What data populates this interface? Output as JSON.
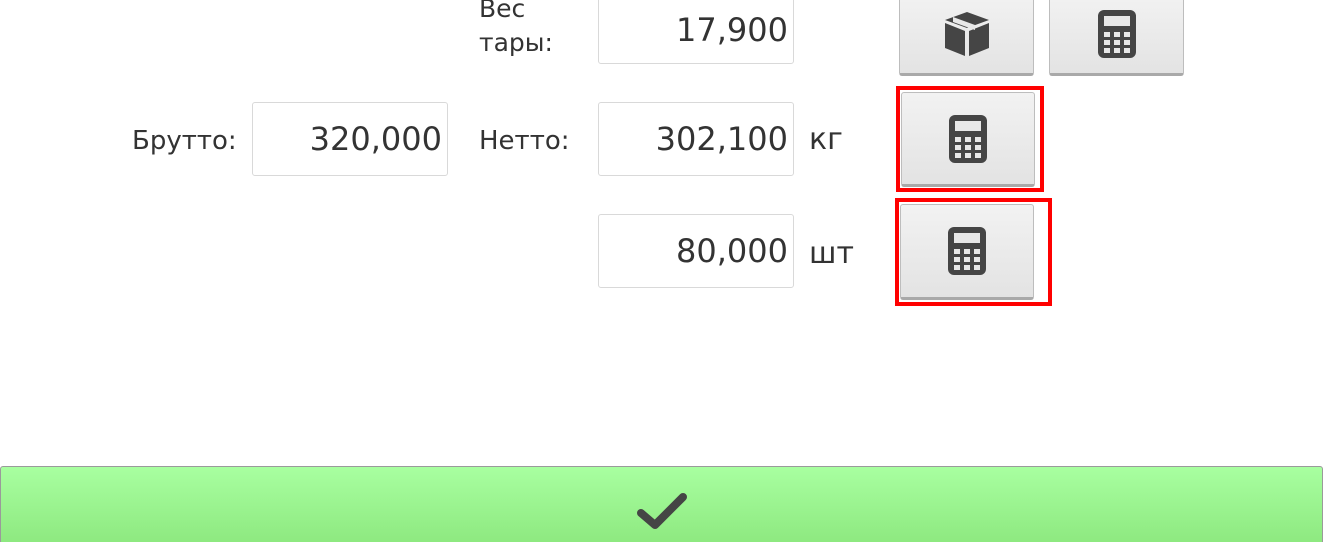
{
  "tare": {
    "label_line1": "Вес",
    "label_line2": "тары:",
    "value": "17,900"
  },
  "gross": {
    "label": "Брутто:",
    "value": "320,000"
  },
  "net": {
    "label": "Нетто:",
    "value": "302,100",
    "unit": "кг"
  },
  "pieces": {
    "value": "80,000",
    "unit": "шт"
  },
  "icons": {
    "package": "box-icon",
    "calculator": "calculator-icon",
    "confirm": "check-icon"
  },
  "colors": {
    "confirm_bar": "#98f08c",
    "highlight": "#ff0000",
    "icon": "#454545"
  }
}
